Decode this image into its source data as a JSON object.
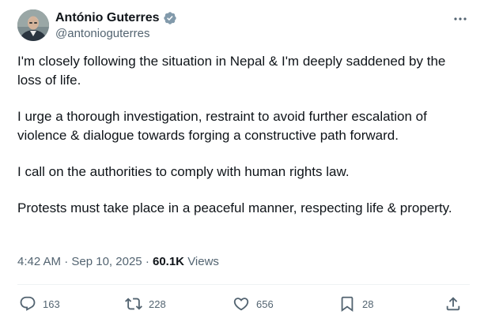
{
  "author": {
    "display_name": "António Guterres",
    "handle": "@antonioguterres",
    "verified": true,
    "avatar_icon": "profile-photo"
  },
  "tweet": {
    "paragraphs": [
      "I'm closely following the situation in Nepal & I'm deeply saddened by the loss of life.",
      "I urge a thorough investigation, restraint to avoid further escalation of violence & dialogue towards forging a constructive path forward.",
      "I call on the authorities to comply with human rights law.",
      "Protests must take place in a peaceful manner, respecting life & property."
    ]
  },
  "meta": {
    "time": "4:42 AM",
    "separator": "·",
    "date": "Sep 10, 2025",
    "views_count": "60.1K",
    "views_label": "Views"
  },
  "actions": {
    "replies": "163",
    "reposts": "228",
    "likes": "656",
    "bookmarks": "28"
  },
  "colors": {
    "text": "#0f1419",
    "secondary": "#536471",
    "verified": "#829aab",
    "divider": "#eff3f4"
  }
}
